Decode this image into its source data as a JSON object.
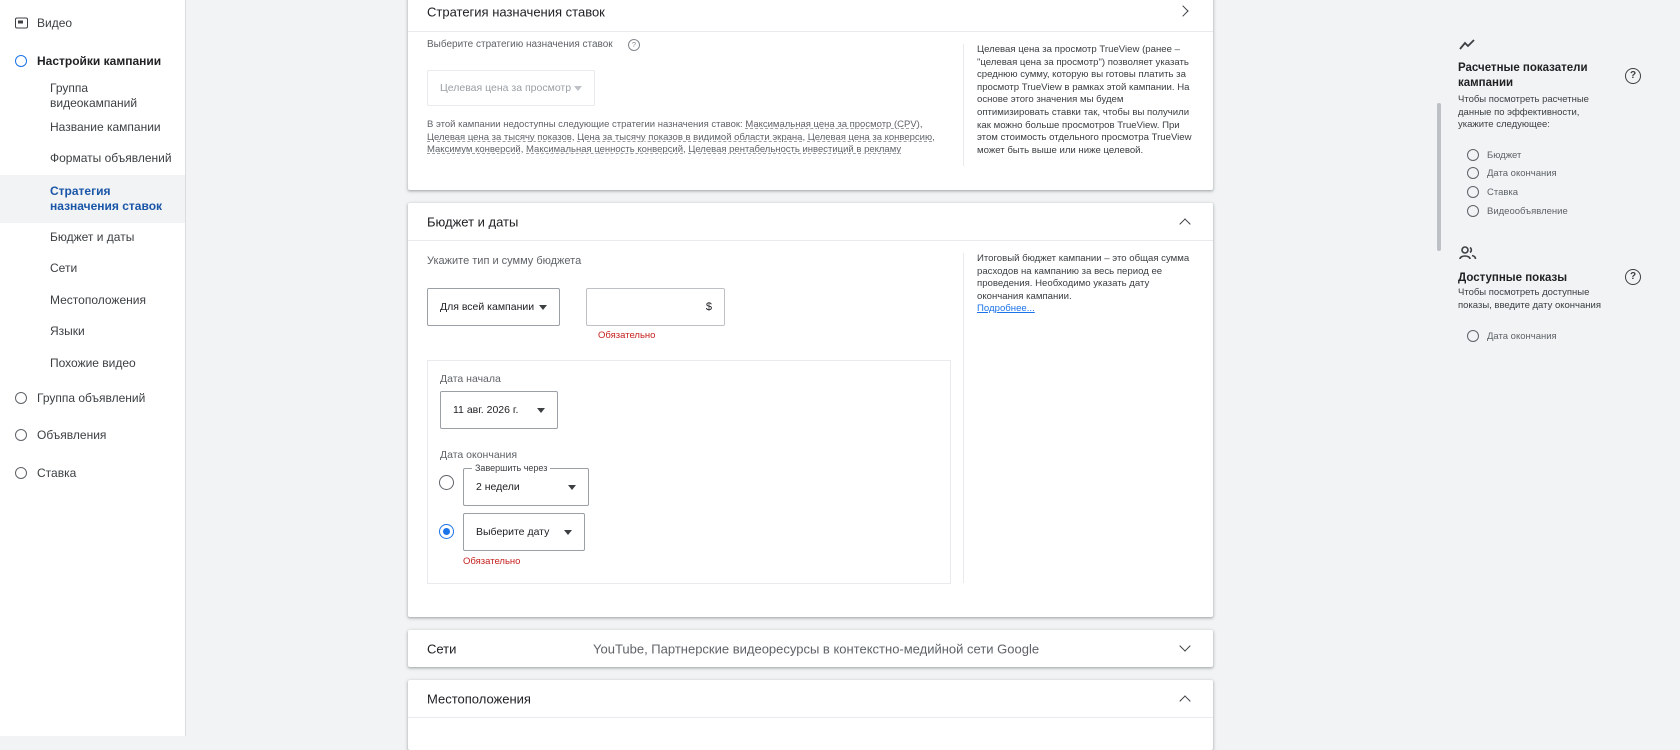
{
  "nav": {
    "video": "Видео",
    "campaign_settings": "Настройки кампании",
    "sub_items": [
      "Группа видеокампаний",
      "Название кампании",
      "Форматы объявлений",
      "Стратегия назначения ставок",
      "Бюджет и даты",
      "Сети",
      "Местоположения",
      "Языки",
      "Похожие видео"
    ],
    "ad_group": "Группа объявлений",
    "ads": "Объявления",
    "bid": "Ставка"
  },
  "bidding": {
    "title": "Стратегия назначения ставок",
    "select_label": "Выберите стратегию назначения ставок",
    "dropdown_value": "Целевая цена за просмотр",
    "unavailable_prefix": "В этой кампании недоступны следующие стратегии назначения ставок:",
    "unavailable_links": [
      "Максимальная цена за просмотр (CPV)",
      "Целевая цена за тысячу показов",
      "Цена за тысячу показов в видимой области экрана",
      "Целевая цена за конверсию",
      "Максимум конверсий",
      "Максимальная ценность конверсий",
      "Целевая рентабельность инвестиций в рекламу"
    ],
    "side_note": "Целевая цена за просмотр TrueView (ранее – \"целевая цена за просмотр\") позволяет указать среднюю сумму, которую вы готовы платить за просмотр TrueView в рамках этой кампании. На основе этого значения мы будем оптимизировать ставки так, чтобы вы получили как можно больше просмотров TrueView. При этом стоимость отдельного просмотра TrueView может быть выше или ниже целевой."
  },
  "budget": {
    "title": "Бюджет и даты",
    "type_label": "Укажите тип и сумму бюджета",
    "type_value": "Для всей кампании",
    "amount_value": "",
    "currency": "$",
    "required": "Обязательно",
    "start_label": "Дата начала",
    "start_value": "11 авг. 2026 г.",
    "end_label": "Дата окончания",
    "end_after_label": "Завершить через",
    "end_after_value": "2 недели",
    "pick_date": "Выберите дату",
    "end_required": "Обязательно",
    "side_note": "Итоговый бюджет кампании – это общая сумма расходов на кампанию за весь период ее проведения. Необходимо указать дату окончания кампании.",
    "more_link": "Подробнее..."
  },
  "networks": {
    "title": "Сети",
    "summary": "YouTube, Партнерские видеоресурсы в контекстно-медийной сети Google"
  },
  "locations": {
    "title": "Местоположения"
  },
  "right_panel": {
    "metrics_title": "Расчетные показатели кампании",
    "metrics_desc": "Чтобы посмотреть расчетные данные по эффективности, укажите следующее:",
    "metrics_items": [
      "Бюджет",
      "Дата окончания",
      "Ставка",
      "Видеообъявление"
    ],
    "reach_title": "Доступные показы",
    "reach_desc": "Чтобы посмотреть доступные показы, введите дату окончания",
    "reach_items": [
      "Дата окончания"
    ]
  },
  "colors": {
    "accent": "#1a73e8",
    "active_nav": "#1a56a8",
    "error": "#c5221f",
    "background": "#f1f3f4"
  }
}
